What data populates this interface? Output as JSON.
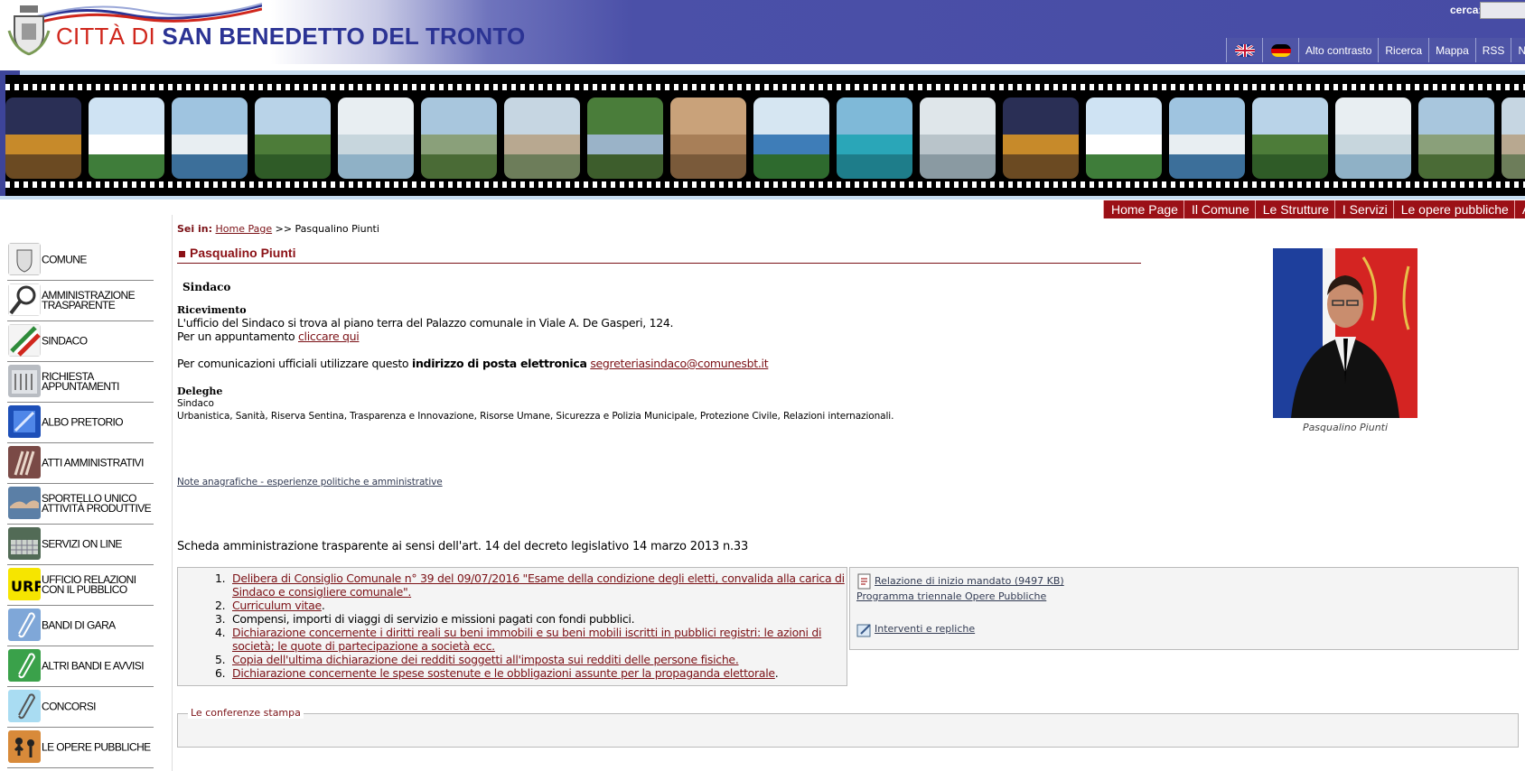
{
  "header": {
    "title_prefix": "CITTÀ DI",
    "title_main": "SAN BENEDETTO DEL TRONTO",
    "search_label": "cerca:",
    "search_value": "",
    "top_links": [
      "Alto contrasto",
      "Ricerca",
      "Mappa",
      "RSS",
      "Ne"
    ],
    "flags": [
      "uk-flag-icon",
      "germany-flag-icon"
    ]
  },
  "main_nav": [
    "Home Page",
    "Il Comune",
    "Le Strutture",
    "I Servizi",
    "Le opere pubbliche",
    "Area"
  ],
  "sidebar": {
    "items": [
      {
        "label": "COMUNE",
        "icon": "city-crest-icon"
      },
      {
        "label": "AMMINISTRAZIONE TRASPARENTE",
        "icon": "magnifier-icon"
      },
      {
        "label": "SINDACO",
        "icon": "tricolor-sash-icon"
      },
      {
        "label": "RICHIESTA APPUNTAMENTI",
        "icon": "building-icon"
      },
      {
        "label": "ALBO PRETORIO",
        "icon": "blue-board-icon"
      },
      {
        "label": "ATTI AMMINISTRATIVI",
        "icon": "books-icon"
      },
      {
        "label": "SPORTELLO UNICO ATTIVITÀ PRODUTTIVE",
        "icon": "handshake-icon"
      },
      {
        "label": "SERVIZI ON LINE",
        "icon": "keyboard-icon"
      },
      {
        "label": "UFFICIO RELAZIONI CON IL PUBBLICO",
        "icon": "urp-logo-icon"
      },
      {
        "label": "BANDI DI GARA",
        "icon": "paperclip-blue-icon"
      },
      {
        "label": "ALTRI BANDI E AVVISI",
        "icon": "paperclip-green-icon"
      },
      {
        "label": "CONCORSI",
        "icon": "paperclip-lightblue-icon"
      },
      {
        "label": "LE OPERE PUBBLICHE",
        "icon": "workers-icon"
      }
    ]
  },
  "breadcrumb": {
    "label": "Sei in:",
    "home": "Home Page",
    "separator": ">>",
    "current": "Pasqualino Piunti"
  },
  "page": {
    "title": "Pasqualino Piunti",
    "role": "Sindaco",
    "ricevimento_label": "Ricevimento",
    "ricevimento_text": "L'ufficio del Sindaco si trova al piano terra del Palazzo comunale in Viale A. De Gasperi, 124.",
    "appuntamento_prefix": "Per un appuntamento",
    "appuntamento_link": "cliccare qui",
    "comunicazioni_prefix": "Per comunicazioni ufficiali utilizzare questo",
    "comunicazioni_bold": "indirizzo di posta elettronica",
    "email": "segreteriasindaco@comunesbt.it",
    "deleghe_label": "Deleghe",
    "deleghe_role": "Sindaco",
    "deleghe_text": "Urbanistica, Sanità, Riserva Sentina, Trasparenza e Innovazione, Risorse Umane, Sicurezza e Polizia Municipale, Protezione Civile, Relazioni internazionali.",
    "note_link": "Note anagrafiche - esperienze politiche e amministrative",
    "photo_caption": "Pasqualino Piunti",
    "scheda_title": "Scheda amministrazione trasparente ai sensi dell'art. 14 del decreto legislativo 14 marzo 2013 n.33",
    "docs": [
      {
        "num": "1.",
        "lines": [
          "Delibera di Consiglio Comunale n° 39 del 09/07/2016 \"Esame della condizione degli eletti, convalida alla carica di",
          "Sindaco e consigliere comunale\"."
        ],
        "link": true
      },
      {
        "num": "2.",
        "lines": [
          "Curriculum vitae"
        ],
        "link": true
      },
      {
        "num": "3.",
        "lines": [
          "Compensi, importi di viaggi di servizio e missioni pagati con fondi pubblici."
        ],
        "link": false
      },
      {
        "num": "4.",
        "lines": [
          "Dichiarazione concernente i diritti reali su beni immobili e su beni mobili iscritti in pubblici registri: le azioni di",
          "società; le quote di partecipazione a società ecc."
        ],
        "link": true
      },
      {
        "num": "5.",
        "lines": [
          "Copia dell'ultima dichiarazione dei redditi soggetti all'imposta sui redditi delle persone fisiche."
        ],
        "link": true
      },
      {
        "num": "6.",
        "lines": [
          "Dichiarazione concernente le spese sostenute e le obbligazioni assunte per la propaganda elettorale"
        ],
        "link": true
      }
    ],
    "side_links": {
      "relazione": "Relazione di inizio mandato (9497 KB)",
      "programma": "Programma triennale Opere Pubbliche",
      "interventi": "Interventi e repliche"
    },
    "press_legend": "Le conferenze stampa"
  },
  "colors": {
    "header_blue": "#474ca5",
    "nav_red": "#9b1016",
    "link_red": "#7b1116",
    "title_red": "#d0271d",
    "title_blue": "#2b3394"
  }
}
